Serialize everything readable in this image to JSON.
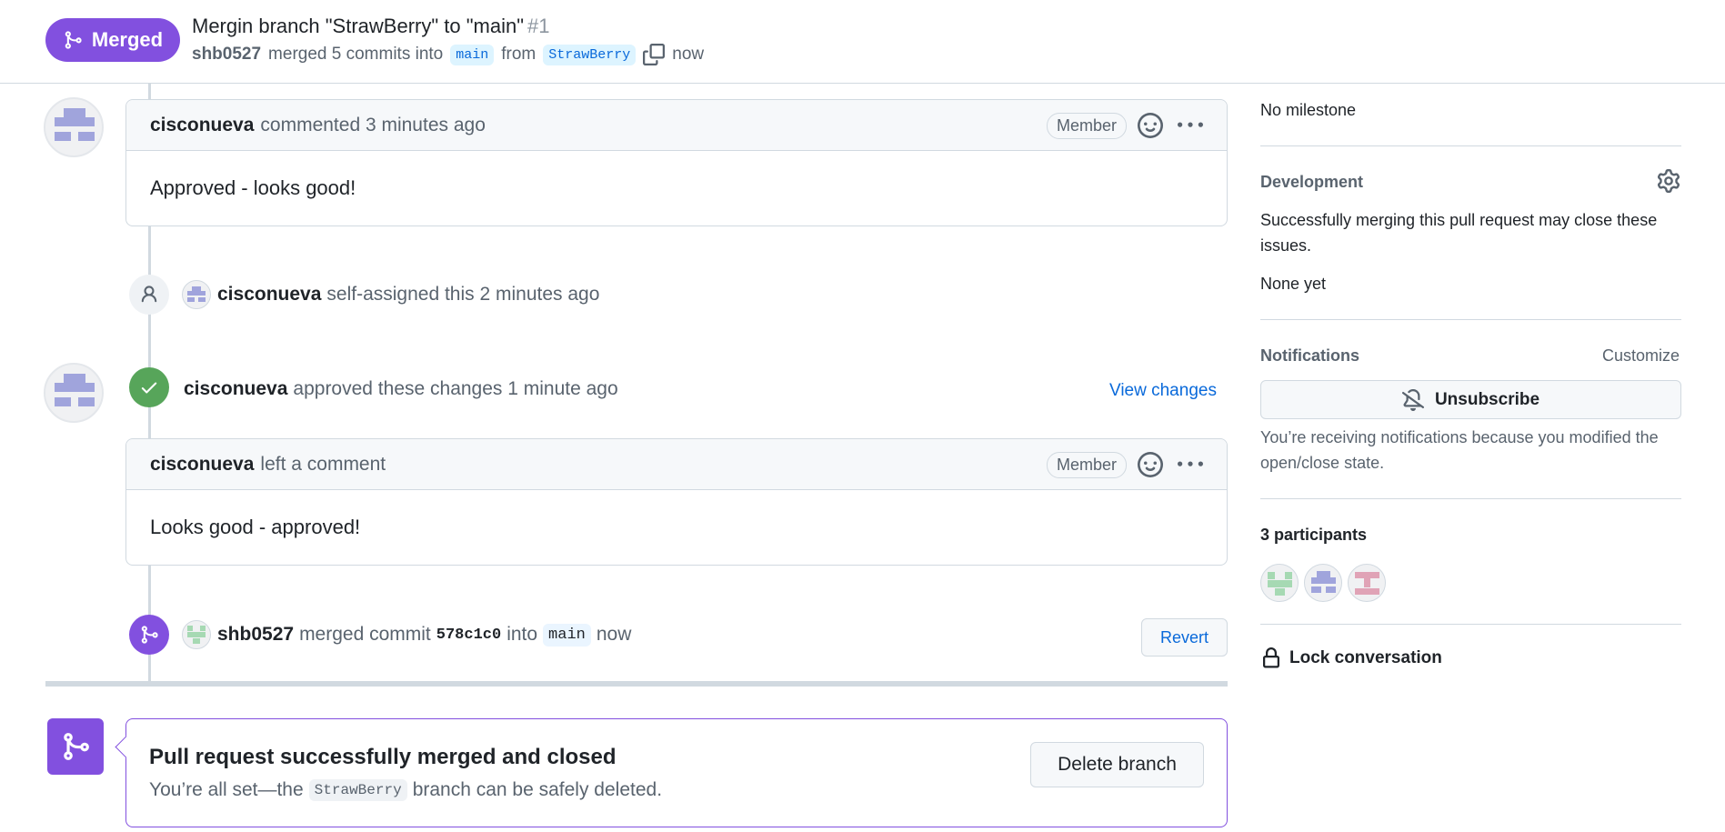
{
  "header": {
    "state_label": "Merged",
    "title": "Mergin branch \"StrawBerry\" to \"main\"",
    "number": "#1",
    "author": "shb0527",
    "merged_text": "merged 5 commits into",
    "base_branch": "main",
    "from_text": "from",
    "head_branch": "StrawBerry",
    "time": "now"
  },
  "timeline": {
    "comment1": {
      "author": "cisconueva",
      "action": "commented 3 minutes ago",
      "role": "Member",
      "body": "Approved - looks good!"
    },
    "assign_event": {
      "author": "cisconueva",
      "text": "self-assigned this 2 minutes ago"
    },
    "review_event": {
      "author": "cisconueva",
      "text": "approved these changes 1 minute ago",
      "view_changes_label": "View changes"
    },
    "comment2": {
      "author": "cisconueva",
      "action": "left a comment",
      "role": "Member",
      "body": "Looks good - approved!"
    },
    "merge_event": {
      "author": "shb0527",
      "text_before_sha": "merged commit",
      "sha": "578c1c0",
      "into_text": "into",
      "branch": "main",
      "time": "now",
      "revert_label": "Revert"
    }
  },
  "merge_status": {
    "title": "Pull request successfully merged and closed",
    "desc_before": "You’re all set—the",
    "branch": "StrawBerry",
    "desc_after": "branch can be safely deleted.",
    "delete_label": "Delete branch"
  },
  "sidebar": {
    "milestone": "No milestone",
    "development": {
      "heading": "Development",
      "text": "Successfully merging this pull request may close these issues.",
      "none": "None yet"
    },
    "notifications": {
      "heading": "Notifications",
      "customize_label": "Customize",
      "unsubscribe_label": "Unsubscribe",
      "reason": "You’re receiving notifications because you modified the open/close state."
    },
    "participants_heading": "3 participants",
    "lock_label": "Lock conversation"
  },
  "colors": {
    "merged_purple": "#8250df",
    "approved_green": "#1f883d",
    "link_blue": "#0969da"
  }
}
